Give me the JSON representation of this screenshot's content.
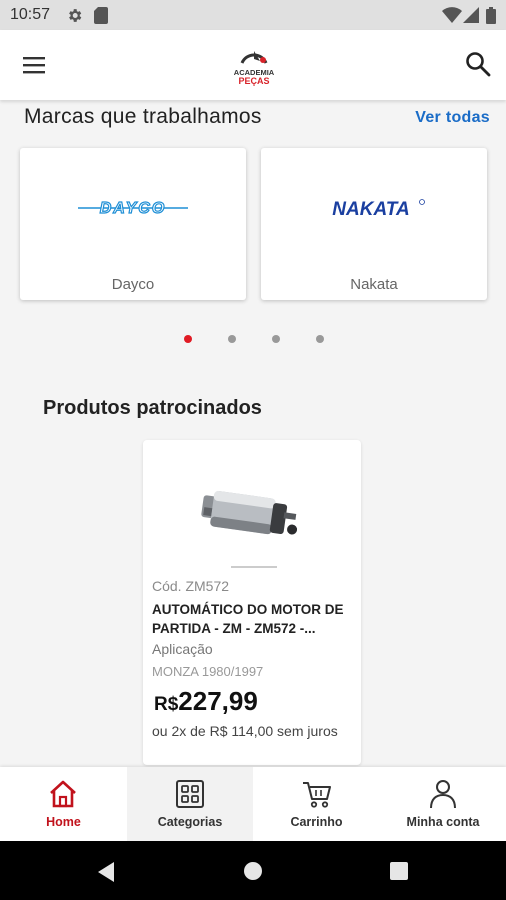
{
  "status_bar": {
    "time": "10:57",
    "left_icons": [
      "gear-icon",
      "sd-card-icon"
    ],
    "right_icons": [
      "wifi-icon",
      "signal-icon",
      "battery-icon"
    ]
  },
  "app_bar": {
    "logo_line1": "ACADEMIA",
    "logo_line2": "PEÇAS",
    "menu_icon": "hamburger-menu-icon",
    "search_icon": "search-icon"
  },
  "brands": {
    "title": "Marcas que trabalhamos",
    "see_all": "Ver todas",
    "items": [
      {
        "logo_text": "DAYCO",
        "name": "Dayco",
        "color": "#1f8fd6"
      },
      {
        "logo_text": "NAKATA",
        "name": "Nakata",
        "color": "#1a3fa0"
      }
    ],
    "carousel": {
      "count": 4,
      "active_index": 0,
      "active_color": "#e01b24"
    }
  },
  "sponsored": {
    "title": "Produtos patrocinados",
    "products": [
      {
        "code": "Cód. ZM572",
        "name": "AUTOMÁTICO DO MOTOR DE PARTIDA - ZM - ZM572 -...",
        "application_label": "Aplicação",
        "application_value": "MONZA 1980/1997",
        "currency": "R$",
        "price": "227,99",
        "installments": "ou 2x de R$ 114,00 sem juros"
      }
    ]
  },
  "bottom_nav": {
    "items": [
      {
        "label": "Home",
        "icon": "home-icon",
        "active": true
      },
      {
        "label": "Categorias",
        "icon": "grid-icon",
        "active": false
      },
      {
        "label": "Carrinho",
        "icon": "cart-icon",
        "active": false
      },
      {
        "label": "Minha conta",
        "icon": "user-icon",
        "active": false
      }
    ],
    "active_color": "#c1121c"
  },
  "system_nav": {
    "icons": [
      "back-icon",
      "home-circle-icon",
      "recents-icon"
    ]
  }
}
